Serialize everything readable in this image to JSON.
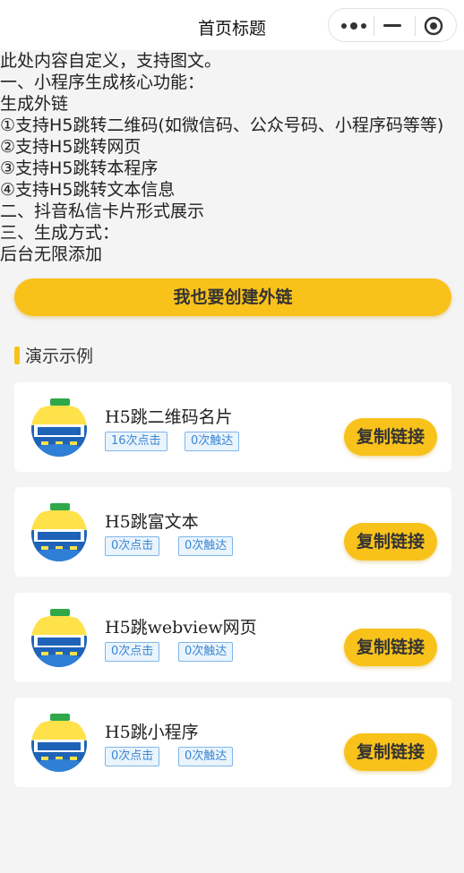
{
  "navbar": {
    "title": "首页标题",
    "icons": [
      "more-icon",
      "minimize-icon",
      "close-icon"
    ]
  },
  "intro": {
    "lines": [
      "此处内容自定义，支持图文。",
      "一、小程序生成核心功能：",
      "生成外链",
      "①支持H5跳转二维码(如微信码、公众号码、小程序码等等)",
      "②支持H5跳转网页",
      "③支持H5跳转本程序",
      "④支持H5跳转文本信息",
      "二、抖音私信卡片形式展示",
      "三、生成方式：",
      "后台无限添加"
    ]
  },
  "create_button": "我也要创建外链",
  "demo_section": {
    "title": "演示示例",
    "copy_label": "复制链接",
    "cards": [
      {
        "title": "H5跳二维码名片",
        "clicks": "16次点击",
        "reach": "0次触达"
      },
      {
        "title": "H5跳富文本",
        "clicks": "0次点击",
        "reach": "0次触达"
      },
      {
        "title": "H5跳webview网页",
        "clicks": "0次点击",
        "reach": "0次触达"
      },
      {
        "title": "H5跳小程序",
        "clicks": "0次点击",
        "reach": "0次触达"
      }
    ]
  },
  "colors": {
    "accent": "#f9c21b",
    "badge_border": "#7fb6e8",
    "badge_text": "#3a86d1",
    "background": "#f4f4f4"
  }
}
